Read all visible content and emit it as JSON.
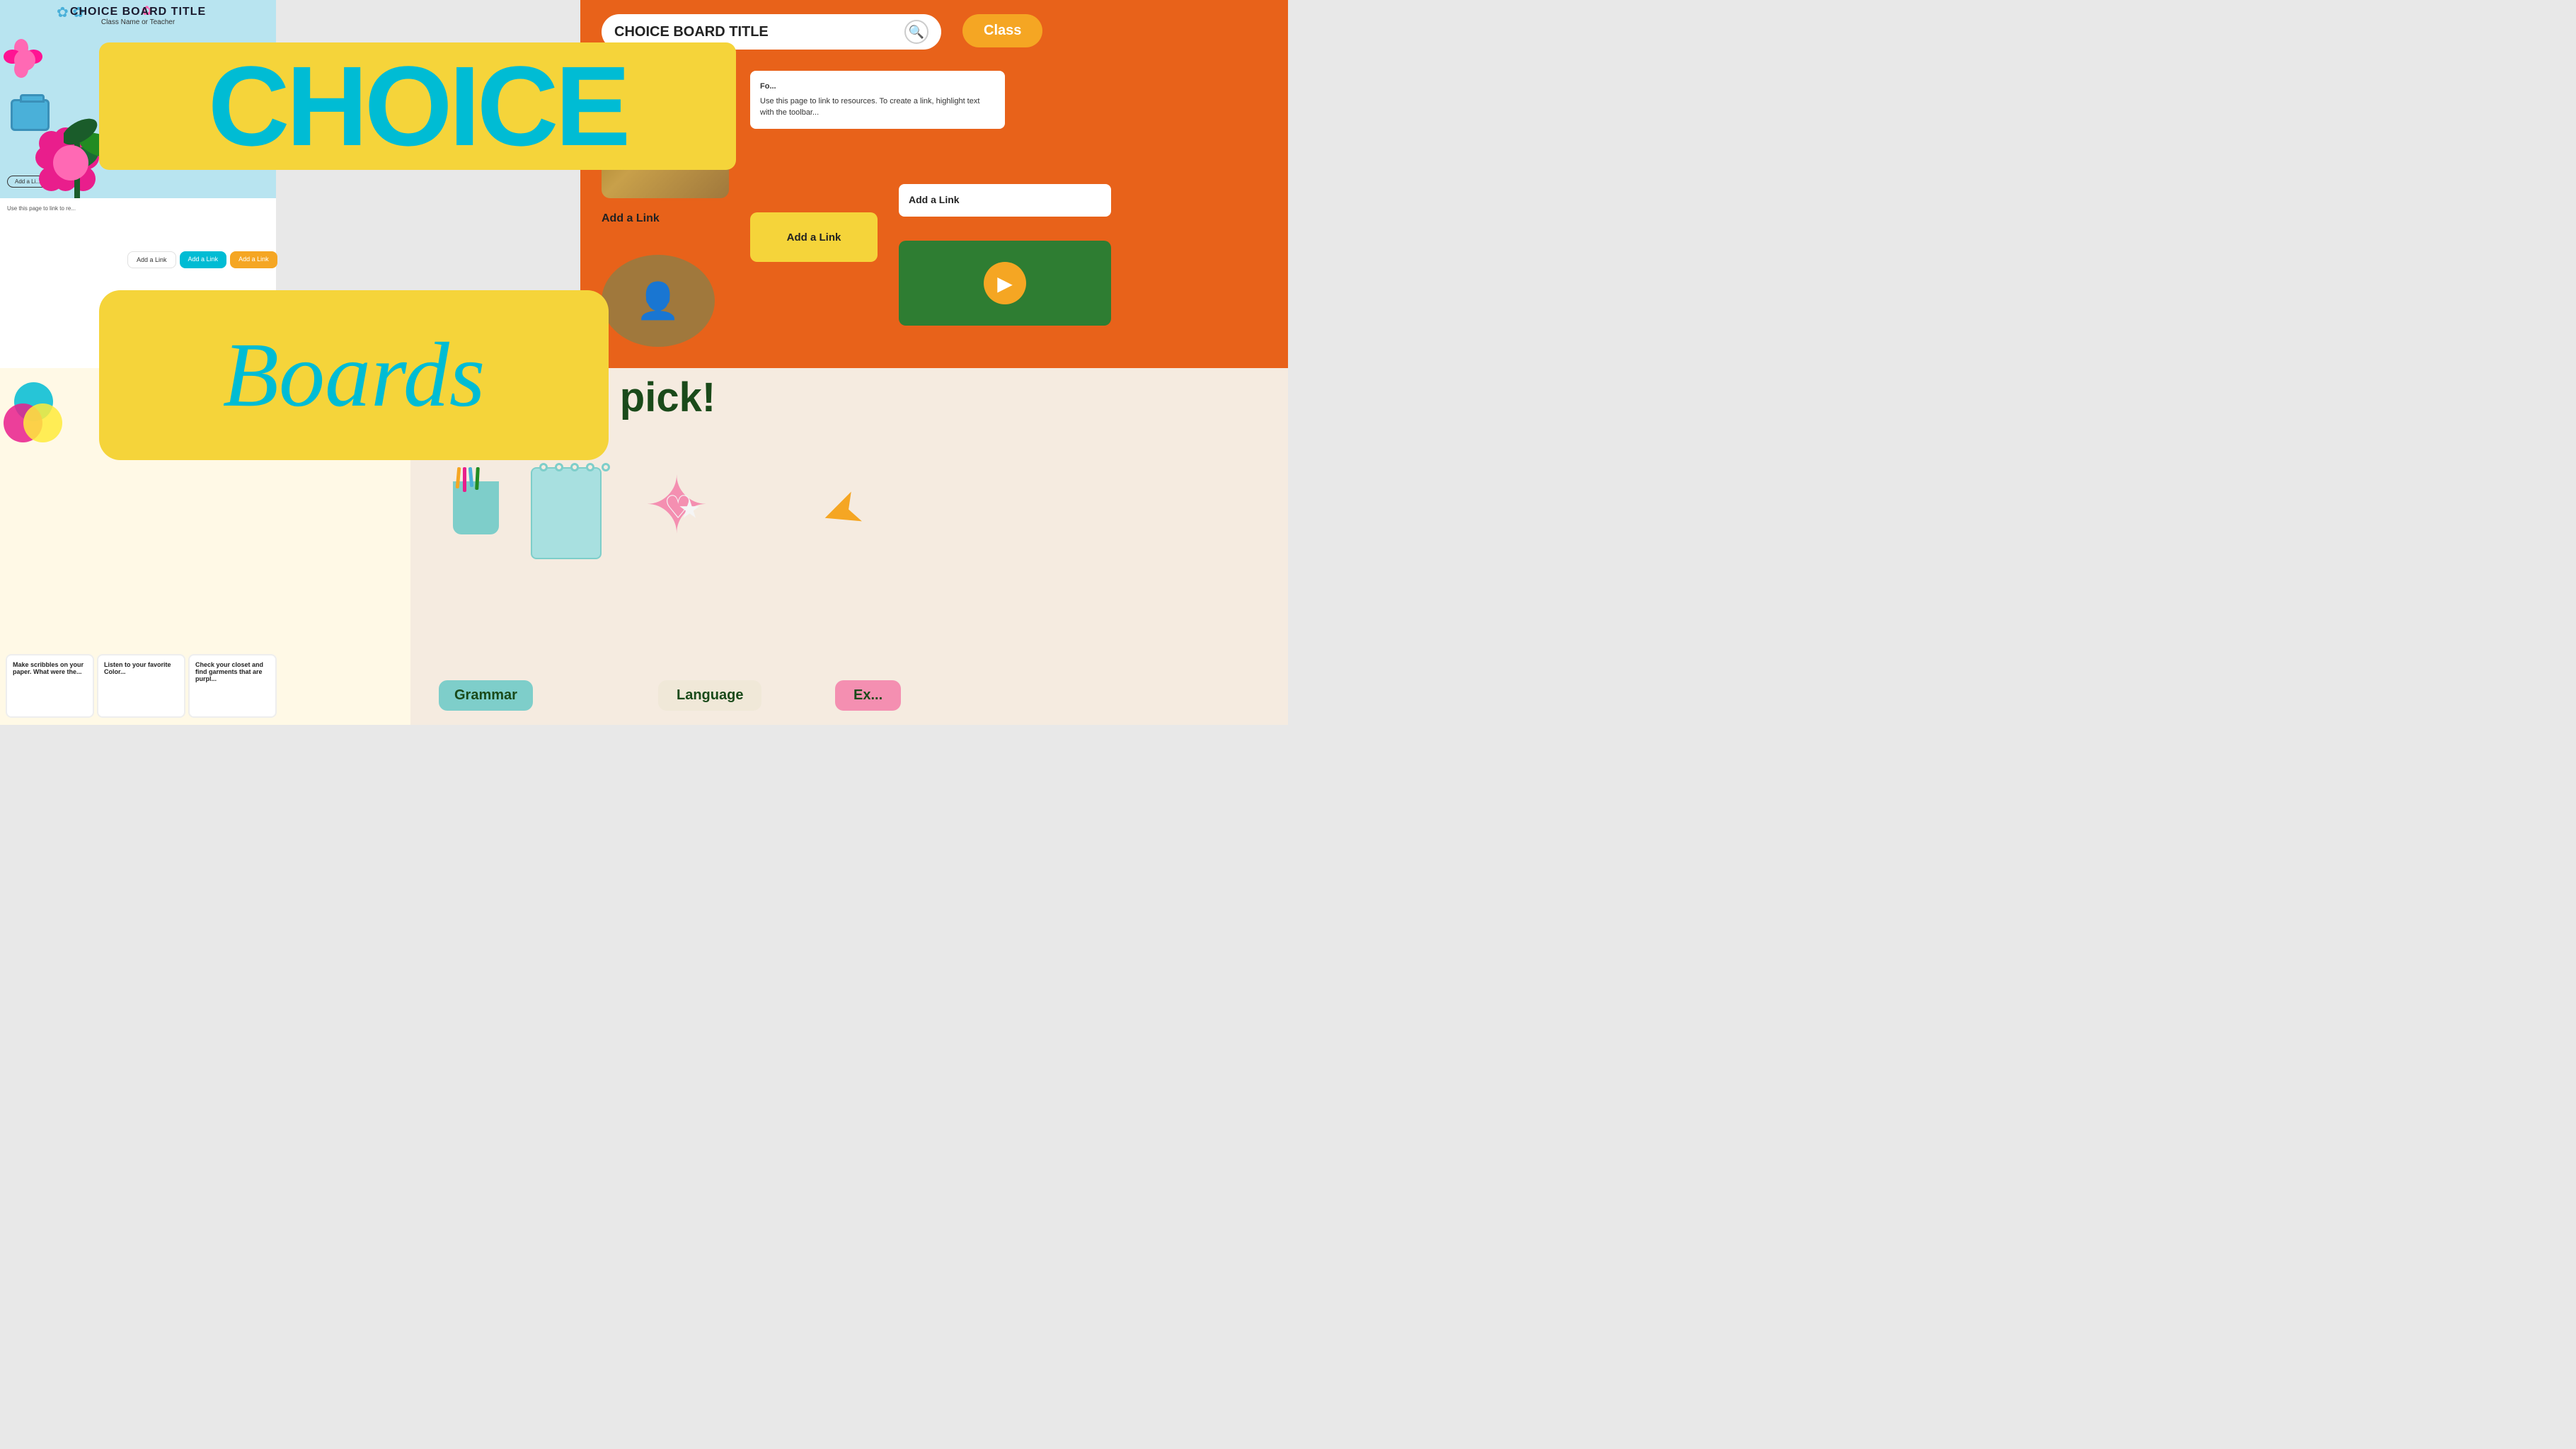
{
  "page": {
    "title": "Choice Boards"
  },
  "topleft_slide": {
    "title": "CHOICE BOARD TITLE",
    "subtitle": "Class Name or Teacher",
    "add_link": "Add a Li..."
  },
  "choice_banner": {
    "text": "CHOICE"
  },
  "boards_banner": {
    "text": "Boards"
  },
  "topright_slide": {
    "search_placeholder": "CHOICE BOARD TITLE",
    "class_tab": "Class",
    "add_link_1": "Add a Link",
    "add_link_2": "Add a Link",
    "add_link_3": "Add a Link",
    "white_card_text": "Use this page to link to resources. To create a link, highlight text with the toolbar...",
    "for_label": "Fo..."
  },
  "bottomright_slide": {
    "headline": "Take your pick!",
    "btn1": "Grammar",
    "btn2": "Language",
    "btn3": "Ex..."
  },
  "bottomleft_cards": {
    "card1": "Make scribbles on your paper. What were the...",
    "card2": "Listen to your favorite Color...",
    "card3": "Check your closet and find garments that are purpl..."
  },
  "mid_cards": {
    "card1_label": "Add a Link",
    "card2_label": "Add a Link",
    "card3_label": "Add a Link"
  },
  "use_this_page": "Use this page to link to re...",
  "icons": {
    "search": "🔍",
    "play": "▶",
    "pencils": "✏️",
    "star": "⭐",
    "heart": "♡",
    "arrow": "➤"
  }
}
